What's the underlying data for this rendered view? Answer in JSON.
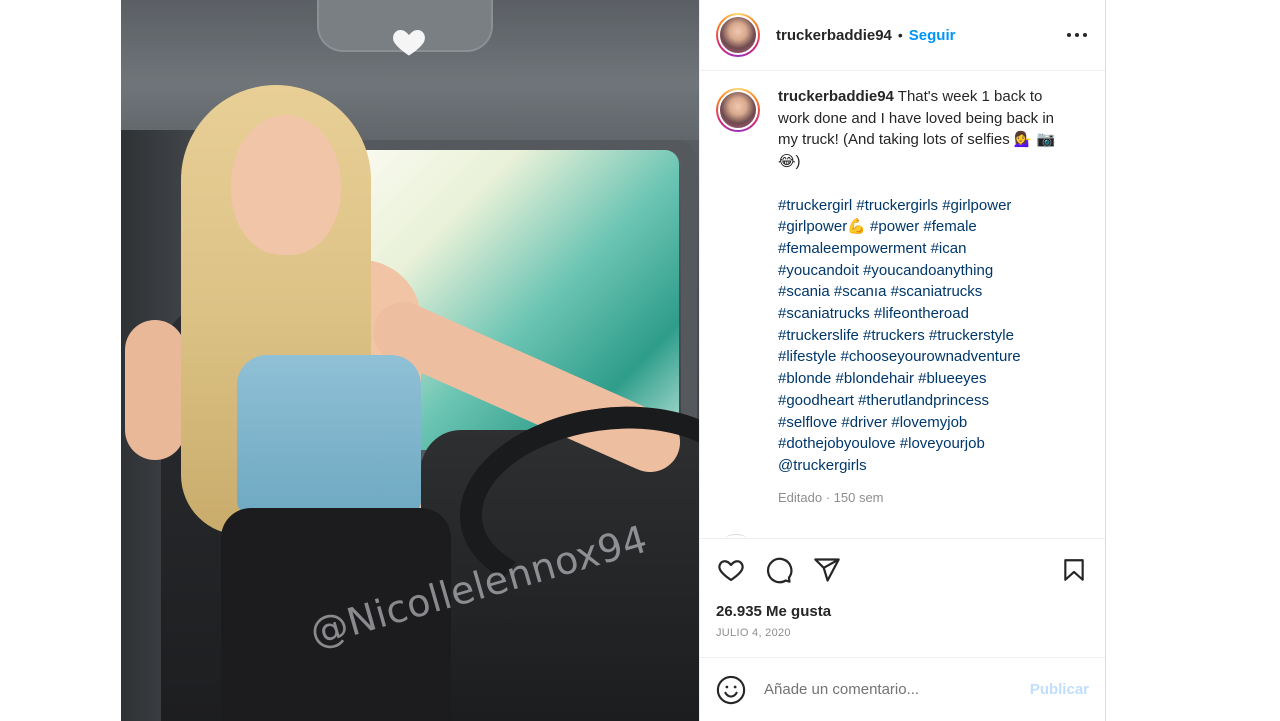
{
  "post": {
    "username": "truckerbaddie94",
    "separator": "•",
    "follow_label": "Seguir",
    "watermark": "@Nicollelennox94"
  },
  "caption": {
    "username": "truckerbaddie94",
    "text": "That's week 1 back to work done and I have loved being back in my truck! (And taking lots of selfies 💁‍♀️ 📷 😂)",
    "hashtag_lines": [
      "#truckergirl #truckergirls #girlpower",
      "#girlpower💪 #power #female",
      "#femaleempowerment #ican",
      "#youcandoit #youcandoanything",
      "#scania #scanıa #scaniatrucks",
      "#scaniatrucks #lifeontheroad",
      "#truckerslife #truckers #truckerstyle",
      "#lifestyle #chooseyourownadventure",
      "#blonde #blondehair #blueeyes",
      "#goodheart #therutlandprincess",
      "#selflove #driver #lovemyjob",
      "#dothejobyoulove #loveyourjob",
      "@truckergirls"
    ],
    "meta": "Editado · 150 sem"
  },
  "stats": {
    "likes": "26.935 Me gusta",
    "date": "JULIO 4, 2020"
  },
  "comment_box": {
    "placeholder": "Añade un comentario...",
    "publish_label": "Publicar"
  },
  "icons": {
    "photo_overlay": "heart-icon",
    "header_menu": "more-options-icon",
    "like": "heart-outline-icon",
    "comment": "speech-bubble-icon",
    "share": "paper-plane-icon",
    "save": "bookmark-icon",
    "emoji": "smiley-icon"
  },
  "colors": {
    "link_blue": "#0095f6",
    "hashtag": "#00376b",
    "publish_disabled": "#c0dffd",
    "muted": "#8e8e8e"
  }
}
